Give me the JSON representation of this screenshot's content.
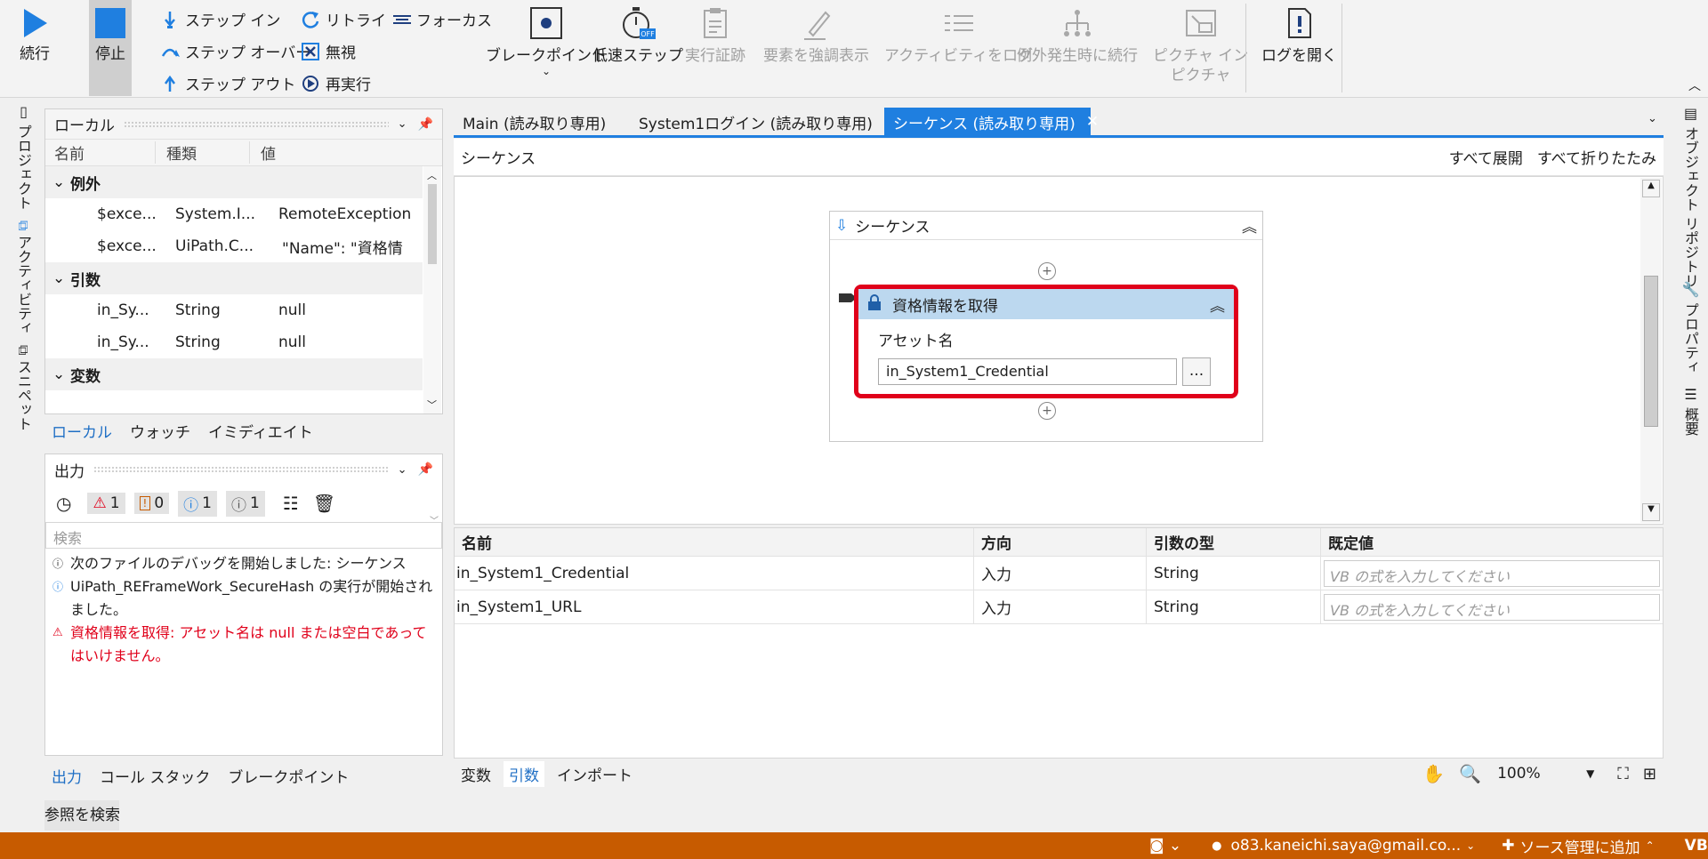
{
  "ribbon": {
    "continue": "続行",
    "stop": "停止",
    "step_in": "ステップ イン",
    "step_over": "ステップ オーバー",
    "step_out": "ステップ アウト",
    "retry": "リトライ",
    "ignore": "無視",
    "restart": "再実行",
    "focus": "フォーカス",
    "breakpoint": "ブレークポイント",
    "slow_step": "低速ステップ",
    "exec_trail": "実行証跡",
    "highlight": "要素を強調表示",
    "log_activity": "アクティビティをログ",
    "continue_on_exception": "例外発生時に続行",
    "pip_line1": "ピクチャ イン",
    "pip_line2": "ピクチャ",
    "open_log": "ログを開く",
    "slow_step_badge": "OFF"
  },
  "left_strip": [
    "プロジェクト",
    "アクティビティ",
    "スニペット"
  ],
  "right_strip": [
    "オブジェクト リポジトリ",
    "プロパティ",
    "概要"
  ],
  "locals": {
    "title": "ローカル",
    "columns": [
      "名前",
      "種類",
      "値"
    ],
    "groups": [
      {
        "label": "例外",
        "rows": [
          {
            "name": "$exce...",
            "type": "System.I...",
            "value": "RemoteException"
          },
          {
            "name": "$exce...",
            "type": "UiPath.C...",
            "value": "\"Name\": \"資格情"
          }
        ]
      },
      {
        "label": "引数",
        "rows": [
          {
            "name": "in_Sy...",
            "type": "String",
            "value": "null"
          },
          {
            "name": "in_Sy...",
            "type": "String",
            "value": "null"
          }
        ]
      },
      {
        "label": "変数",
        "rows": []
      }
    ],
    "tabs": [
      "ローカル",
      "ウォッチ",
      "イミディエイト"
    ]
  },
  "output": {
    "title": "出力",
    "counts": {
      "error": "1",
      "warning": "0",
      "info": "1",
      "trace": "1"
    },
    "search_placeholder": "検索",
    "messages": [
      {
        "kind": "info",
        "text": "次のファイルのデバッグを開始しました: シーケンス"
      },
      {
        "kind": "info",
        "text": "UiPath_REFrameWork_SecureHash の実行が開始されました。"
      },
      {
        "kind": "error",
        "text": "資格情報を取得: アセット名は null または空白であってはいけません。"
      }
    ],
    "tabs": [
      "出力",
      "コール スタック",
      "ブレークポイント"
    ]
  },
  "search_refs": "参照を検索",
  "doc_tabs": [
    "Main (読み取り専用)",
    "System1ログイン (読み取り専用)",
    "シーケンス (読み取り専用)"
  ],
  "breadcrumb": "シーケンス",
  "expand_all": "すべて展開",
  "collapse_all": "すべて折りたたみ",
  "sequence": {
    "title": "シーケンス",
    "activity_title": "資格情報を取得",
    "asset_label": "アセット名",
    "asset_value": "in_System1_Credential",
    "browse": "..."
  },
  "arguments": {
    "columns": [
      "名前",
      "方向",
      "引数の型",
      "既定値"
    ],
    "rows": [
      {
        "name": "in_System1_Credential",
        "direction": "入力",
        "type": "String",
        "default": "VB の式を入力してください"
      },
      {
        "name": "in_System1_URL",
        "direction": "入力",
        "type": "String",
        "default": "VB の式を入力してください"
      }
    ]
  },
  "bottom_tabs": [
    "変数",
    "引数",
    "インポート"
  ],
  "zoom": "100%",
  "status": {
    "account": "o83.kaneichi.saya@gmail.co...",
    "source_control": "ソース管理に追加",
    "lang": "VB"
  },
  "colors": {
    "accent": "#1f7fe0",
    "error": "#e0001a",
    "status_bar": "#c75b00"
  }
}
